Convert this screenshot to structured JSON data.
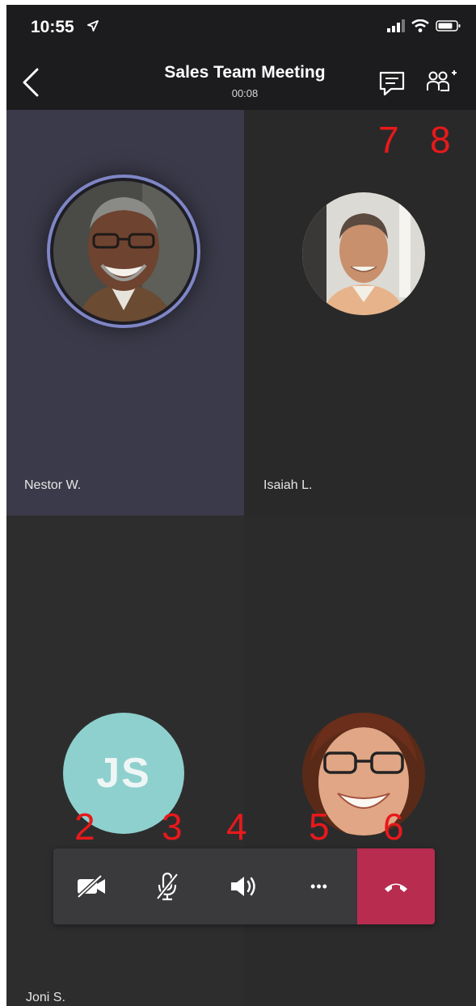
{
  "status_bar": {
    "time": "10:55"
  },
  "header": {
    "title": "Sales Team Meeting",
    "timer": "00:08"
  },
  "participants": [
    {
      "name": "Nestor W.",
      "speaking": true
    },
    {
      "name": "Isaiah L."
    },
    {
      "name": "Joni S.",
      "initials": "JS",
      "avatar_color": "#8ed0cd"
    },
    {
      "name": ""
    }
  ],
  "controls": {
    "camera_icon": "camera-off-icon",
    "mic_icon": "mic-off-icon",
    "speaker_icon": "speaker-icon",
    "more_label": "•••",
    "hangup_icon": "hang-up-icon",
    "hangup_color": "#b72c4f"
  },
  "markers": [
    "7",
    "8",
    "2",
    "3",
    "4",
    "5",
    "6"
  ],
  "colors": {
    "accent_ring": "#7f86c6",
    "marker": "#e8191b"
  }
}
